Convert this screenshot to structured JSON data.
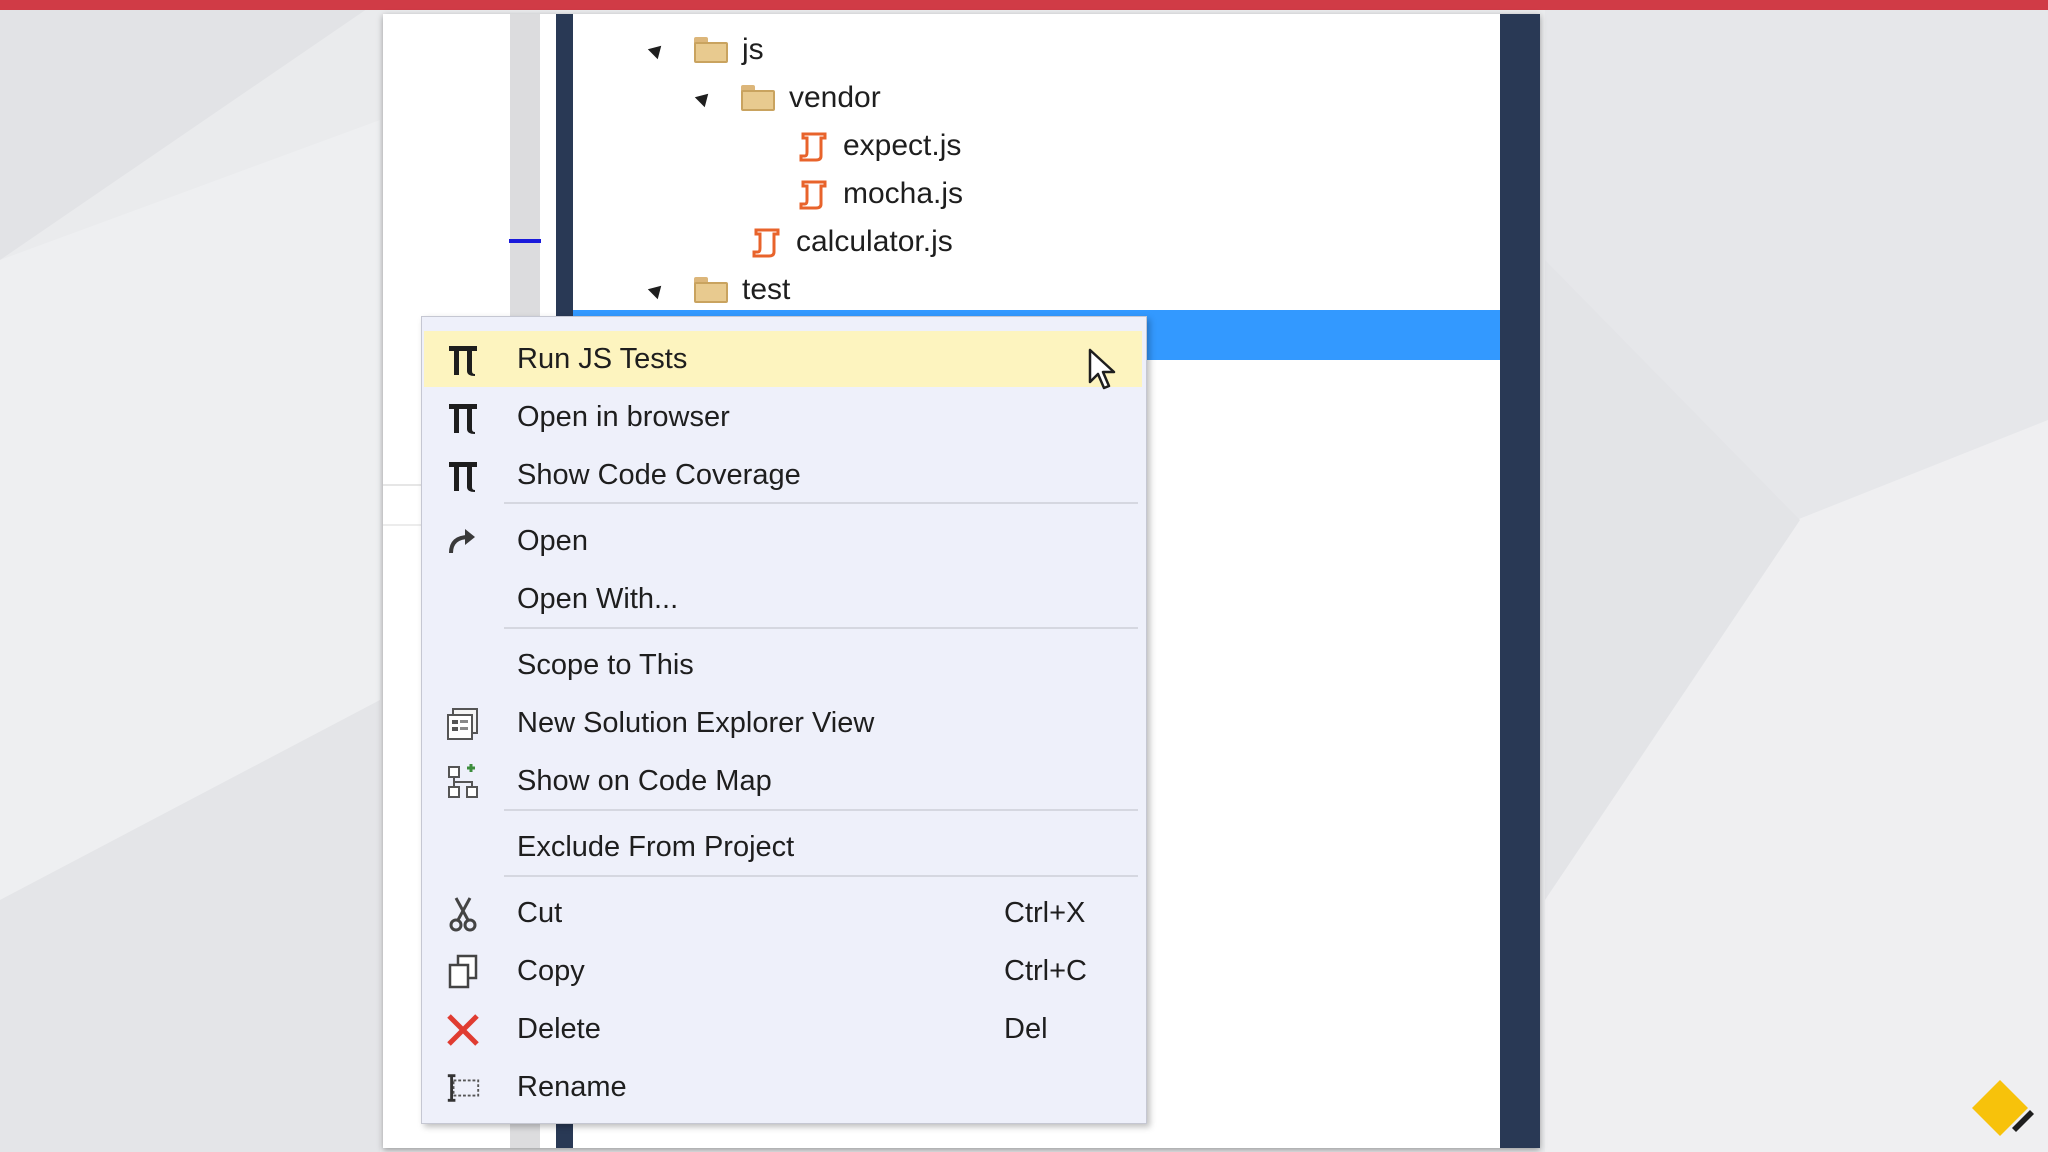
{
  "tree": {
    "items": [
      {
        "label": "js",
        "type": "folder"
      },
      {
        "label": "vendor",
        "type": "folder"
      },
      {
        "label": "expect.js",
        "type": "js-file"
      },
      {
        "label": "mocha.js",
        "type": "js-file"
      },
      {
        "label": "calculator.js",
        "type": "js-file"
      },
      {
        "label": "test",
        "type": "folder"
      }
    ]
  },
  "menu": {
    "items": [
      {
        "label": "Run JS Tests",
        "icon": "chutzpah-icon",
        "highlighted": true
      },
      {
        "label": "Open in browser",
        "icon": "chutzpah-icon"
      },
      {
        "label": "Show Code Coverage",
        "icon": "chutzpah-icon"
      },
      {
        "label": "Open",
        "icon": "open-arrow-icon"
      },
      {
        "label": "Open With...",
        "icon": ""
      },
      {
        "label": "Scope to This",
        "icon": ""
      },
      {
        "label": "New Solution Explorer View",
        "icon": "solution-explorer-view-icon"
      },
      {
        "label": "Show on Code Map",
        "icon": "code-map-icon"
      },
      {
        "label": "Exclude From Project",
        "icon": ""
      },
      {
        "label": "Cut",
        "icon": "scissors-icon",
        "shortcut": "Ctrl+X"
      },
      {
        "label": "Copy",
        "icon": "copy-icon",
        "shortcut": "Ctrl+C"
      },
      {
        "label": "Delete",
        "icon": "delete-x-icon",
        "shortcut": "Del"
      },
      {
        "label": "Rename",
        "icon": "rename-icon"
      }
    ]
  },
  "colors": {
    "accent_bar": "#d03b46",
    "selection": "#3399ff",
    "menu_background": "#eef0fa",
    "menu_highlight": "#fdf4bf",
    "nav_strip": "#293955",
    "delete_icon": "#e03c31",
    "js_icon": "#e8632b"
  }
}
